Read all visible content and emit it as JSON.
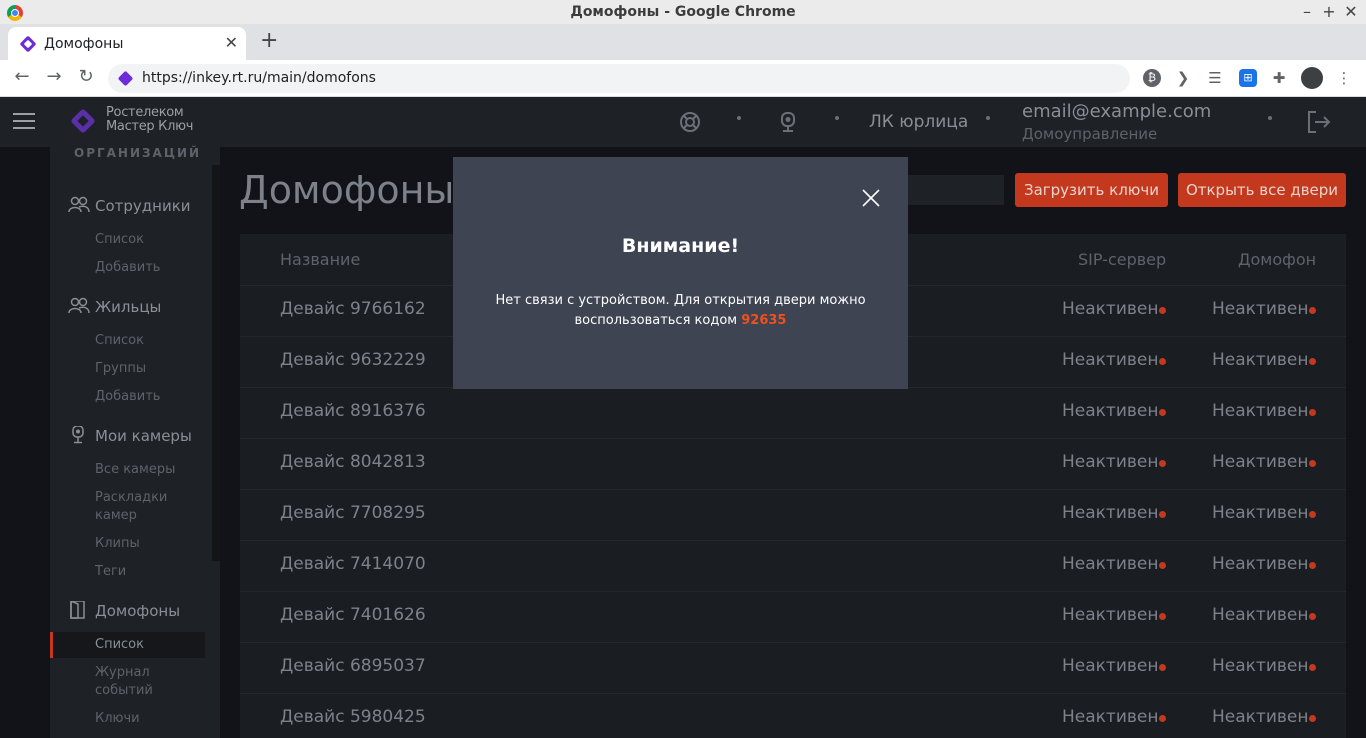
{
  "window": {
    "title": "Домофоны - Google Chrome"
  },
  "tab": {
    "title": "Домофоны",
    "close": "✕",
    "new": "+"
  },
  "toolbar": {
    "url": "https://inkey.rt.ru/main/domofons"
  },
  "header": {
    "logo_line1": "Ростелеком",
    "logo_line2": "Мастер Ключ",
    "lk_link": "ЛК юрлица",
    "email": "email@example.com",
    "role": "Домоуправление"
  },
  "sidebar": {
    "org_label": "ОРГАНИЗАЦИЙ",
    "sections": [
      {
        "label": "Сотрудники",
        "icon": "users-icon",
        "items": [
          "Список",
          "Добавить"
        ]
      },
      {
        "label": "Жильцы",
        "icon": "users-icon",
        "items": [
          "Список",
          "Группы",
          "Добавить"
        ]
      },
      {
        "label": "Мои камеры",
        "icon": "camera-icon",
        "items": [
          "Все камеры",
          "Раскладки камер",
          "Клипы",
          "Теги"
        ]
      },
      {
        "label": "Домофоны",
        "icon": "door-icon",
        "items": [
          "Список",
          "Журнал событий",
          "Ключи"
        ]
      }
    ]
  },
  "main": {
    "title": "Домофоны",
    "upload_keys": "Загрузить ключи",
    "open_all": "Открыть все двери",
    "columns": {
      "name": "Название",
      "sip": "SIP-сервер",
      "domofon": "Домофон"
    },
    "rows": [
      {
        "name": "Девайс 9766162",
        "sip": "Неактивен",
        "domofon": "Неактивен"
      },
      {
        "name": "Девайс 9632229",
        "sip": "Неактивен",
        "domofon": "Неактивен"
      },
      {
        "name": "Девайс 8916376",
        "sip": "Неактивен",
        "domofon": "Неактивен"
      },
      {
        "name": "Девайс 8042813",
        "sip": "Неактивен",
        "domofon": "Неактивен"
      },
      {
        "name": "Девайс 7708295",
        "sip": "Неактивен",
        "domofon": "Неактивен"
      },
      {
        "name": "Девайс 7414070",
        "sip": "Неактивен",
        "domofon": "Неактивен"
      },
      {
        "name": "Девайс 7401626",
        "sip": "Неактивен",
        "domofon": "Неактивен"
      },
      {
        "name": "Девайс 6895037",
        "sip": "Неактивен",
        "domofon": "Неактивен"
      },
      {
        "name": "Девайс 5980425",
        "sip": "Неактивен",
        "domofon": "Неактивен"
      }
    ]
  },
  "modal": {
    "title": "Внимание!",
    "text_line1": "Нет связи с устройством. Для открытия двери можно",
    "text_line2": "воспользоваться кодом",
    "code": "92635"
  },
  "colors": {
    "accent": "#c4381d",
    "code": "#f0501e",
    "modal_bg": "#3e4452",
    "status_dot": "#c4381d"
  }
}
